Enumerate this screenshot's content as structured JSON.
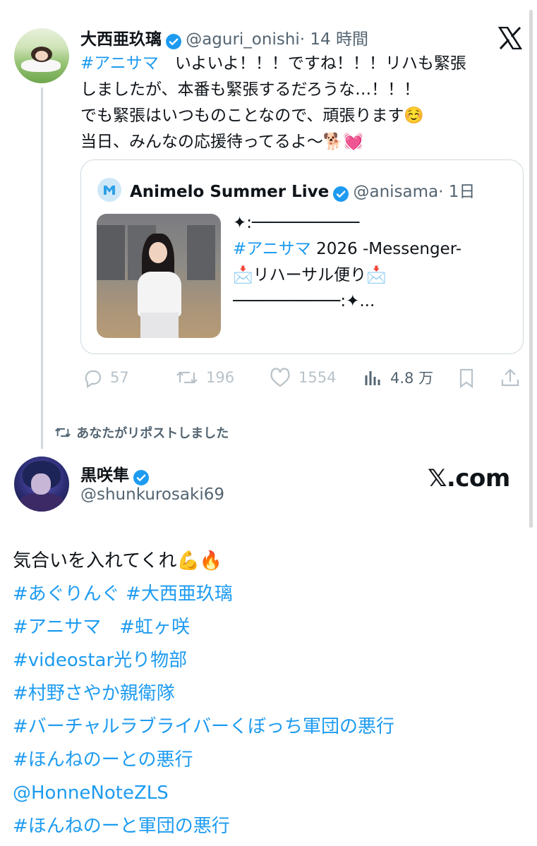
{
  "first_tweet": {
    "name": "大西亜玖璃",
    "handle": "@aguri_onishi",
    "time": "· 14 時間",
    "lines": [
      {
        "tag": "#アニサマ",
        "text": "　いよいよ！！！ですね！！！リハも緊張"
      },
      {
        "text": "しましたが、本番も緊張するだろうな…！！！"
      },
      {
        "text": "でも緊張はいつものことなので、頑張ります☺️"
      },
      {
        "text": "当日、みんなの応援待ってるよ〜🐕💓"
      }
    ]
  },
  "quote": {
    "name": "Animelo Summer Live",
    "handle": "@anisama",
    "time": "· 1日",
    "line1": "✦:───────────",
    "line2_tag": "#アニサマ",
    "line2_text": " 2026 -Messenger-",
    "line3": "📩リハーサル便り📩",
    "line4": "───────────:✦..."
  },
  "actions": {
    "replies": "57",
    "reposts": "196",
    "likes": "1554",
    "views": "4.8 万"
  },
  "repost_notice": "あなたがリポストしました",
  "second_tweet": {
    "name": "黒咲隼",
    "handle": "@shunkurosaki69",
    "brand": "𝕏.com",
    "lines": [
      {
        "text": "気合いを入れてくれ💪🔥"
      },
      {
        "tag": "#あぐりんぐ  #大西亜玖璃"
      },
      {
        "tag": " #アニサマ　#虹ヶ咲"
      },
      {
        "tag": "#videostar光り物部"
      },
      {
        "tag": " #村野さやか親衛隊"
      },
      {
        "tag": " #バーチャルラブライバーくぼっち軍団の悪行"
      },
      {
        "tag": " #ほんねのーとの悪行"
      },
      {
        "tag": "@HonneNoteZLS"
      },
      {
        "tag": "#ほんねのーと軍団の悪行"
      }
    ]
  },
  "colors": {
    "accent": "#1d9bf0",
    "text": "#0f1419",
    "muted": "#536471",
    "border": "#cfd9de"
  }
}
